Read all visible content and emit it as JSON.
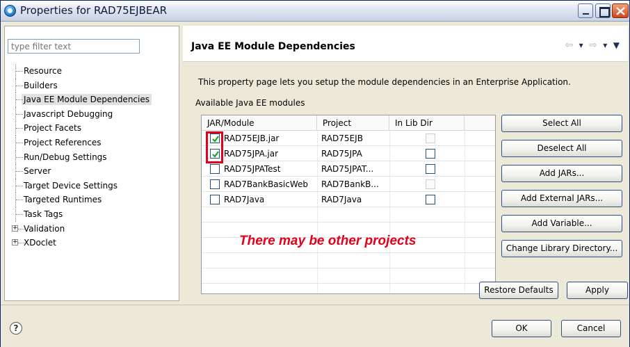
{
  "window": {
    "title": "Properties for RAD75EJBEAR"
  },
  "filter": {
    "placeholder": "type filter text"
  },
  "tree": {
    "items": [
      {
        "label": "Resource"
      },
      {
        "label": "Builders"
      },
      {
        "label": "Java EE Module Dependencies",
        "selected": true
      },
      {
        "label": "Javascript Debugging"
      },
      {
        "label": "Project Facets"
      },
      {
        "label": "Project References"
      },
      {
        "label": "Run/Debug Settings"
      },
      {
        "label": "Server"
      },
      {
        "label": "Target Device Settings"
      },
      {
        "label": "Targeted Runtimes"
      },
      {
        "label": "Task Tags"
      },
      {
        "label": "Validation",
        "expandable": true,
        "expander": "+"
      },
      {
        "label": "XDoclet",
        "expandable": true,
        "expander": "+"
      }
    ]
  },
  "page": {
    "title": "Java EE Module Dependencies",
    "nav": {
      "back": "⇦",
      "forward": "⇨",
      "menu": "▼",
      "dropdown": "▾"
    },
    "description": "This property page lets you setup the module dependencies in an Enterprise Application.",
    "available_label": "Available Java EE modules"
  },
  "table": {
    "headers": {
      "module": "JAR/Module",
      "project": "Project",
      "inlib": "In Lib Dir"
    },
    "rows": [
      {
        "module": "RAD75EJB.jar",
        "project": "RAD75EJB",
        "checked": true,
        "inlib_enabled": false
      },
      {
        "module": "RAD75JPA.jar",
        "project": "RAD75JPA",
        "checked": true,
        "inlib_enabled": true
      },
      {
        "module": "RAD75JPATest",
        "project": "RAD75JPAT...",
        "checked": false,
        "inlib_enabled": true
      },
      {
        "module": "RAD7BankBasicWeb",
        "project": "RAD7BankB...",
        "checked": false,
        "inlib_enabled": false
      },
      {
        "module": "RAD7Java",
        "project": "RAD7Java",
        "checked": false,
        "inlib_enabled": true
      }
    ]
  },
  "annotation": "There may be other projects",
  "buttons": {
    "select_all": "Select All",
    "deselect_all": "Deselect All",
    "add_jars": "Add JARs...",
    "add_external_jars": "Add External JARs...",
    "add_variable": "Add Variable...",
    "change_lib_dir": "Change Library Directory...",
    "restore_defaults": "Restore Defaults",
    "apply": "Apply",
    "ok": "OK",
    "cancel": "Cancel"
  },
  "help": {
    "glyph": "?"
  },
  "colors": {
    "annotation_red": "#e3001b",
    "title_blue": "#0b1a3a"
  }
}
